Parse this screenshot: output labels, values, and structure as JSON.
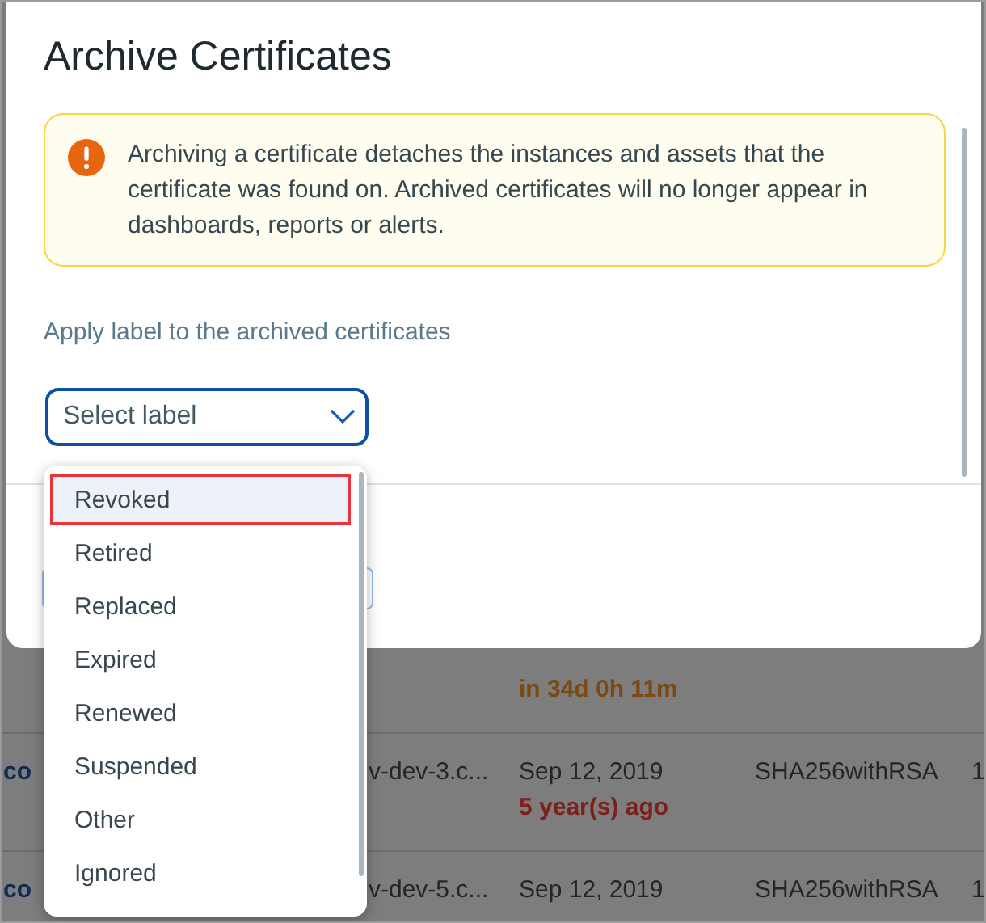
{
  "background_table": {
    "rows": [
      {
        "relative": "in 34d 0h 11m",
        "expired": false
      },
      {
        "column_1": "co",
        "column_2": "v-dev-3.c...",
        "date": "Sep 12, 2019",
        "relative": "5 year(s) ago",
        "expired": true,
        "algorithm": "SHA256withRSA",
        "column_5": "1"
      },
      {
        "column_1": "co",
        "column_2": "v-dev-5.c...",
        "date": "Sep 12, 2019",
        "algorithm": "SHA256withRSA",
        "column_5": "1"
      }
    ]
  },
  "dialog": {
    "title": "Archive Certificates",
    "alert": {
      "text": "Archiving a certificate detaches the instances and assets that the certificate was found on. Archived certificates will no longer appear in dashboards, reports or alerts."
    },
    "label_prompt": "Apply label to the archived certificates",
    "select": {
      "placeholder": "Select label",
      "expanded": true,
      "options": [
        {
          "label": "Revoked",
          "selected": true
        },
        {
          "label": "Retired",
          "selected": false
        },
        {
          "label": "Replaced",
          "selected": false
        },
        {
          "label": "Expired",
          "selected": false
        },
        {
          "label": "Renewed",
          "selected": false
        },
        {
          "label": "Suspended",
          "selected": false
        },
        {
          "label": "Other",
          "selected": false
        },
        {
          "label": "Ignored",
          "selected": false
        }
      ]
    }
  }
}
